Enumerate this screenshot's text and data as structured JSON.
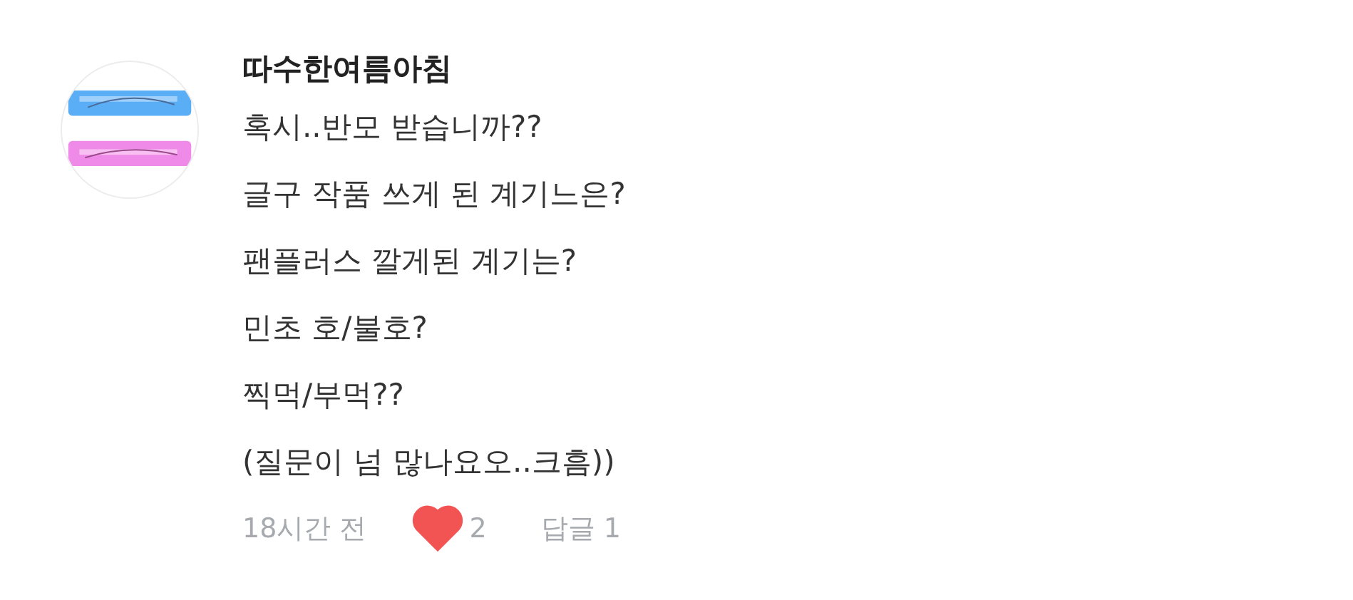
{
  "comment": {
    "author": "따수한여름아침",
    "lines": [
      "혹시..반모 받습니까??",
      "글구 작품 쓰게 된 계기느은?",
      "팬플러스 깔게된 계기는?",
      "민초 호/불호?",
      "찍먹/부먹??",
      "(질문이 넘 많나요오..크흠))"
    ],
    "time": "18시간 전",
    "liked": true,
    "like_count": "2",
    "reply_label": "답글 1"
  }
}
